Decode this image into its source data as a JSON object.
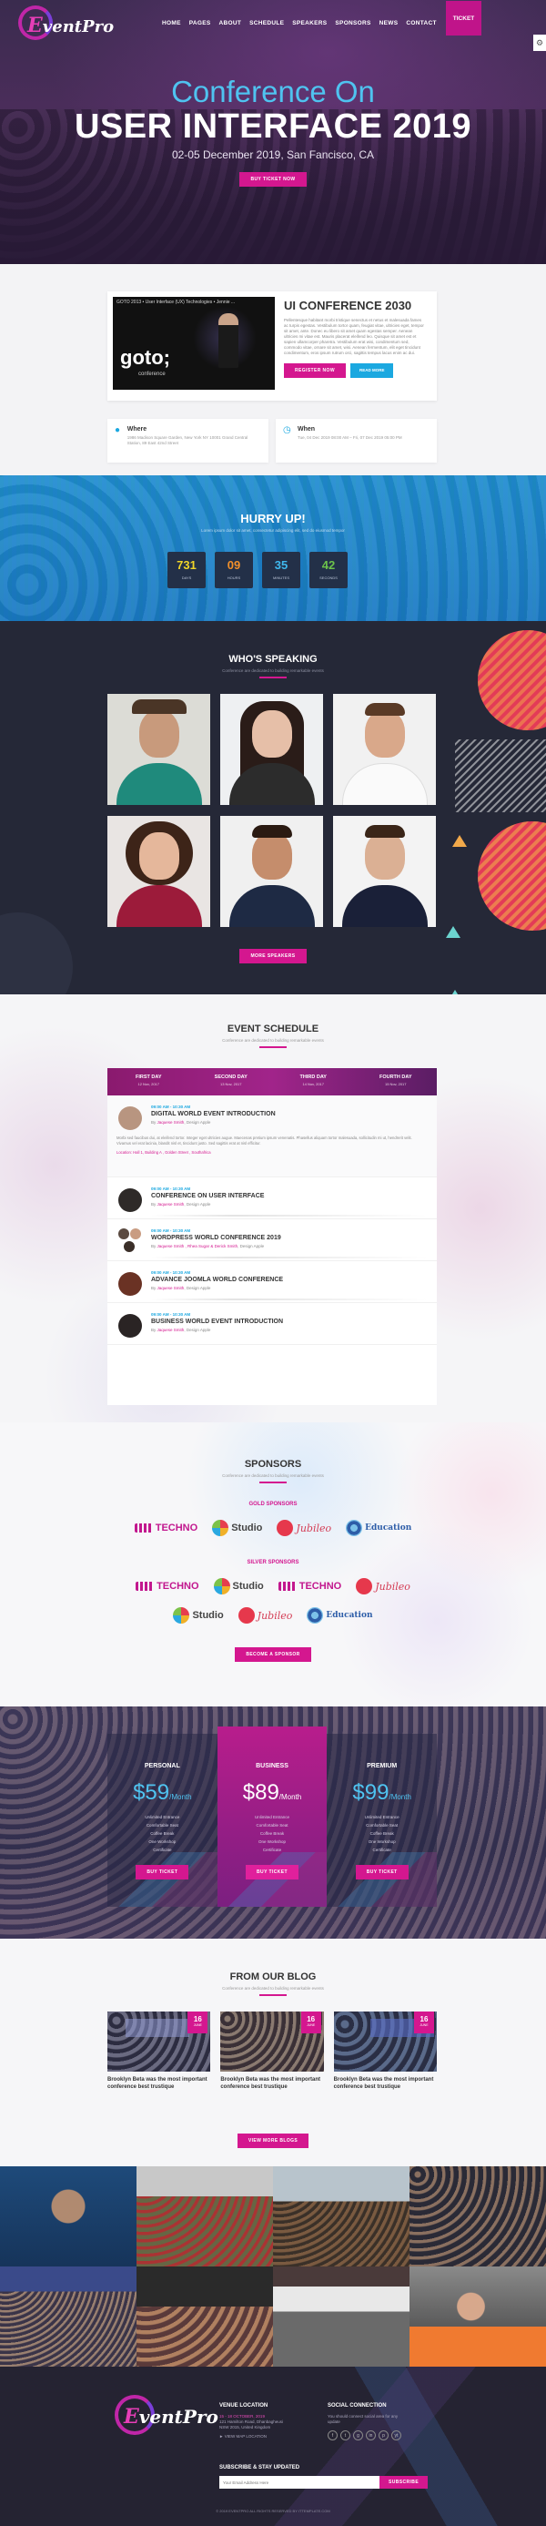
{
  "nav": {
    "logo_prefix": "E",
    "logo_text": "ventPro",
    "items": [
      "HOME",
      "PAGES",
      "ABOUT",
      "SCHEDULE",
      "SPEAKERS",
      "SPONSORS",
      "NEWS",
      "CONTACT"
    ],
    "ticket": "TICKET"
  },
  "hero": {
    "subtitle": "Conference On",
    "title": "USER INTERFACE 2019",
    "date": "02-05 December 2019, San Fancisco, CA",
    "button": "BUY TICKET NOW"
  },
  "about": {
    "video_title": "GOTO 2013 • User Interface (UX) Technologies • Jennie ...",
    "video_brand": "goto;",
    "video_brand_sub": "conference",
    "title": "UI CONFERENCE 2030",
    "text": "Pellentesque habitant morbi tristique senectus et netus et malesuada fames ac turpis egestas. Vestibulum tortor quam, feugiat vitae, ultricies eget, tempor sit amet, ante. Donec eu libero sit amet quam egestas semper. Aenean ultricies mi vitae est. Mauris placerat eleifend leo. Quisque sit amet est et sapien ullamcorper pharetra. Vestibulum erat wisi, condimentum sed, commodo vitae, ornare sit amet, wisi. Aenean fermentum, elit eget tincidunt condimentum, eros ipsum rutrum orci, sagittis tempus lacus enim ac dui.",
    "btn_register": "REGISTER NOW",
    "btn_read_more": "READ MORE",
    "where_title": "Where",
    "where_text": "1986 Madison Square Garden, New York NY 10001 Grand Central Station, 89 East 42nd Street",
    "when_title": "When",
    "when_text": "Tue, 04 Dec 2019 08:00 AM – Fri, 07 Dec 2019 05:00 PM"
  },
  "hurry": {
    "title": "HURRY UP!",
    "subtitle": "Lorem ipsum dolor sit amet, consectetur adipiscing elit, sed do eiusmod tempor",
    "counters": [
      {
        "value": "731",
        "label": "DAYS",
        "color": "#f0d528"
      },
      {
        "value": "09",
        "label": "HOURS",
        "color": "#f2902a"
      },
      {
        "value": "35",
        "label": "MINUTES",
        "color": "#3fb8ee"
      },
      {
        "value": "42",
        "label": "SECONDS",
        "color": "#6cc24a"
      }
    ]
  },
  "speakers": {
    "title": "WHO'S SPEAKING",
    "subtitle": "Conference are dedicated to building remarkable events",
    "button": "MORE SPEAKERS"
  },
  "schedule": {
    "title": "EVENT SCHEDULE",
    "subtitle": "Conference are dedicated to building remarkable events",
    "days": [
      {
        "label": "FIRST DAY",
        "date": "12 Nov, 2017"
      },
      {
        "label": "SECOND DAY",
        "date": "13 Nov, 2017"
      },
      {
        "label": "THIRD DAY",
        "date": "14 Nov, 2017"
      },
      {
        "label": "FOURTH DAY",
        "date": "15 Nov, 2017"
      }
    ],
    "events": [
      {
        "time": "09:00 AM - 10:30 AM",
        "title": "DIGITAL WORLD EVENT INTRODUCTION",
        "by": "By",
        "speaker": "Jaquese Smith",
        "role": ", Design Apple",
        "desc": "Morbi sed faucibus dui, at eleifend tortor. Integer eget ultricies augue. Maecenas pretium ipsum venenatis. Phasellus aliquam tortor malesuada, sollicitudin mi ut, hendrerit velit. Vivamus vel erat lacinia, blandit nisl et, tincidunt justo. Sed sagittis erat at nisl efficitur.",
        "tags": "Location: Hall 1, Building A , Golden Street , Southafrica"
      },
      {
        "time": "09:00 AM - 10:30 AM",
        "title": "CONFERENCE ON USER INTERFACE",
        "by": "By",
        "speaker": "Jaquese Smith",
        "role": ", Design Apple"
      },
      {
        "time": "09:00 AM - 10:30 AM",
        "title": "WORDPRESS WORLD CONFERENCE 2019",
        "by": "By",
        "speaker": "Jaquese Smith , Rhea Sugar & Derick Smith",
        "role": ", Design Apple"
      },
      {
        "time": "09:00 AM - 10:30 AM",
        "title": "ADVANCE JOOMLA WORLD CONFERENCE",
        "by": "By",
        "speaker": "Jaquese Smith",
        "role": ", Design Apple"
      },
      {
        "time": "09:00 AM - 10:30 AM",
        "title": "BUSINESS WORLD EVENT INTRODUCTION",
        "by": "By",
        "speaker": "Jaquese Smith",
        "role": ", Design Apple"
      }
    ]
  },
  "sponsors": {
    "title": "SPONSORS",
    "subtitle": "Conference are dedicated to building remarkable events",
    "gold_label": "GOLD SPONSORS",
    "silver_label": "SILVER SPONSORS",
    "gold": [
      "TECHNO",
      "Studio",
      "Jubileo",
      "Education"
    ],
    "silver_row1": [
      "TECHNO",
      "Studio",
      "TECHNO",
      "Jubileo"
    ],
    "silver_row2": [
      "Studio",
      "Jubileo",
      "Education"
    ],
    "button": "BECOME A SPONSOR"
  },
  "pricing": {
    "plans": [
      {
        "name": "PERSONAL",
        "price": "$59",
        "per": "/Month",
        "features": [
          "Unlimited Entrance",
          "Comfortable Seat",
          "Coffee Break",
          "One Workshop",
          "Certificate"
        ],
        "button": "BUY TICKET"
      },
      {
        "name": "BUSINESS",
        "price": "$89",
        "per": "/Month",
        "features": [
          "Unlimited Entrance",
          "Comfortable Seat",
          "Coffee Break",
          "One Workshop",
          "Certificate"
        ],
        "button": "BUY TICKET"
      },
      {
        "name": "PREMIUM",
        "price": "$99",
        "per": "/Month",
        "features": [
          "Unlimited Entrance",
          "Comfortable Seat",
          "Coffee Break",
          "One Workshop",
          "Certificate"
        ],
        "button": "BUY TICKET"
      }
    ]
  },
  "blog": {
    "title": "FROM OUR BLOG",
    "subtitle": "Conference are dedicated to building remarkable events",
    "posts": [
      {
        "day": "16",
        "month": "JUNE",
        "title": "Brooklyn Beta was the most important conference best trustique"
      },
      {
        "day": "16",
        "month": "JUNE",
        "title": "Brooklyn Beta was the most important conference best trustique"
      },
      {
        "day": "16",
        "month": "JUNE",
        "title": "Brooklyn Beta was the most important conference best trustique"
      }
    ],
    "button": "VIEW MORE BLOGS"
  },
  "footer": {
    "venue_title": "VENUE LOCATION",
    "venue_line1": "15 - 18 OCTOBER, 2019",
    "venue_line2": "121 Hamilton Road, Dhanbagheusi",
    "venue_line3": "NSW 2015, United Kingdom",
    "venue_link": "► VIEW MAP LOCATION",
    "social_title": "SOCIAL CONNECTION",
    "social_text": "You should connect social area for any update",
    "social_icons": [
      "f",
      "t",
      "g",
      "in",
      "p",
      "yt"
    ],
    "subscribe_title": "SUBSCRIBE & STAY UPDATED",
    "subscribe_placeholder": "Your Email Address Here",
    "subscribe_button": "SUBSCRIBE",
    "copyright": "© 2019 EVENTPRO ALL RIGHTS RESERVED BY ITTEMPLATE.COM"
  }
}
